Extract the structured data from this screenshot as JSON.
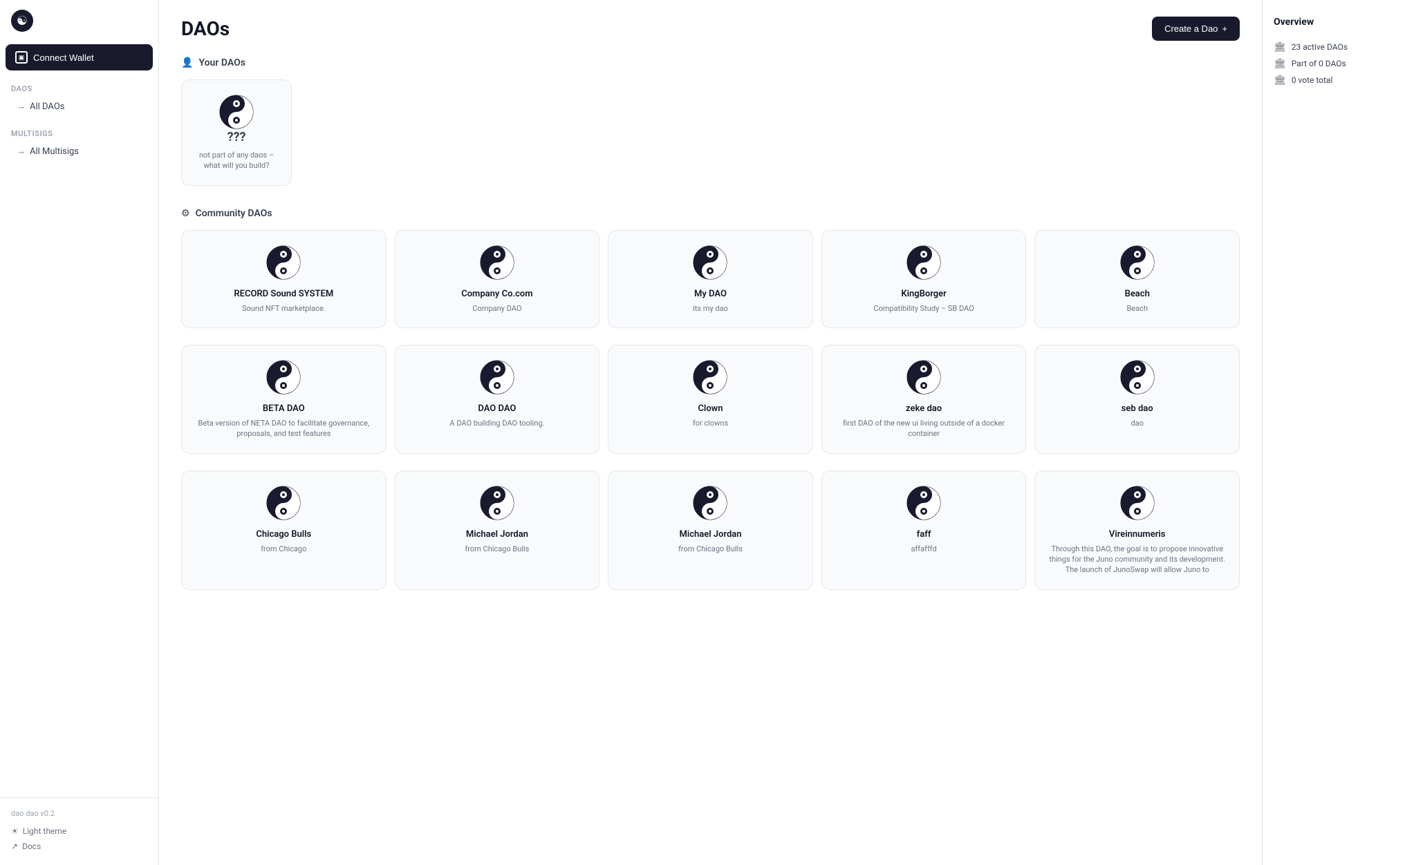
{
  "sidebar": {
    "logo_symbol": "☯",
    "connect_wallet_label": "Connect Wallet",
    "sections": [
      {
        "label": "DAOs",
        "items": [
          {
            "label": "All DAOs",
            "id": "all-daos"
          }
        ]
      },
      {
        "label": "Multisigs",
        "items": [
          {
            "label": "All Multisigs",
            "id": "all-multisigs"
          }
        ]
      }
    ],
    "footer": {
      "version": "dao dao v0.2",
      "theme_label": "Light theme",
      "docs_label": "Docs"
    }
  },
  "header": {
    "title": "DAOs",
    "create_btn": "Create a Dao",
    "create_icon": "+"
  },
  "overview": {
    "title": "Overview",
    "items": [
      {
        "icon": "🏛",
        "label": "23 active DAOs"
      },
      {
        "icon": "🏛",
        "label": "Part of 0 DAOs"
      },
      {
        "icon": "🏛",
        "label": "0 vote total"
      }
    ]
  },
  "your_daos": {
    "section_label": "Your DAOs",
    "section_icon": "👤",
    "empty_card": {
      "question": "???",
      "desc": "not part of any daos – what will you build?"
    }
  },
  "community_daos": {
    "section_label": "Community DAOs",
    "section_icon": "⚙",
    "rows": [
      [
        {
          "name": "RECORD Sound SYSTEM",
          "desc": "Sound NFT marketplace."
        },
        {
          "name": "Company Co.com",
          "desc": "Company DAO"
        },
        {
          "name": "My DAO",
          "desc": "its my dao"
        },
        {
          "name": "KingBorger",
          "desc": "Compatibility Study – SB DAO"
        },
        {
          "name": "Beach",
          "desc": "Beach"
        }
      ],
      [
        {
          "name": "BETA DAO",
          "desc": "Beta version of NETA DAO to facilitate governance, proposals, and test features"
        },
        {
          "name": "DAO DAO",
          "desc": "A DAO building DAO tooling."
        },
        {
          "name": "Clown",
          "desc": "for clowns"
        },
        {
          "name": "zeke dao",
          "desc": "first DAO of the new ui living outside of a docker container"
        },
        {
          "name": "seb dao",
          "desc": "dao"
        }
      ],
      [
        {
          "name": "Chicago Bulls",
          "desc": "from Chicago"
        },
        {
          "name": "Michael Jordan",
          "desc": "from Chicago Bulls"
        },
        {
          "name": "Michael Jordan",
          "desc": "from Chicago Bulls"
        },
        {
          "name": "faff",
          "desc": "affafffd"
        },
        {
          "name": "Vireinnumeris",
          "desc": "Through this DAO, the goal is to propose innovative things for the Juno community and its development. The launch of JunoSwap will allow Juno to"
        }
      ]
    ]
  }
}
